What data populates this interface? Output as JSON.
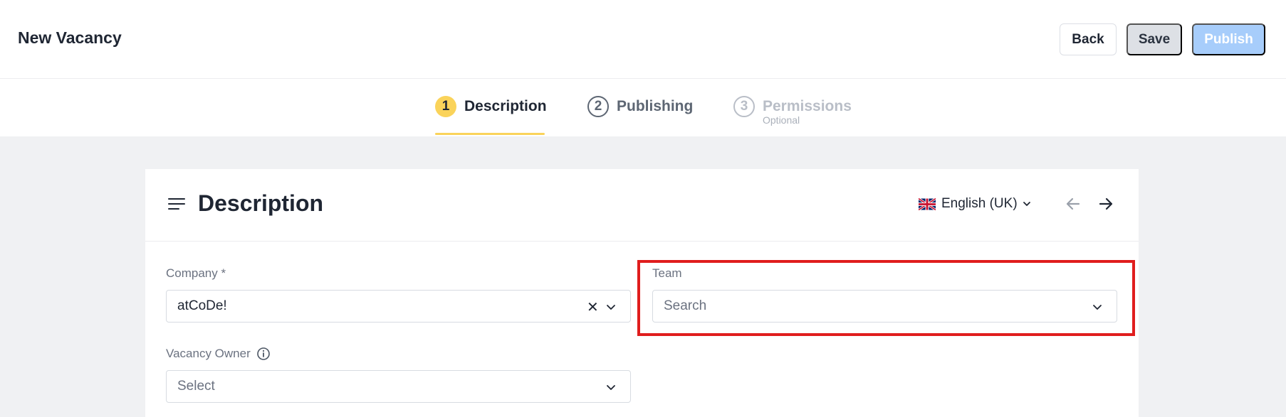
{
  "header": {
    "title": "New Vacancy",
    "back_label": "Back",
    "save_label": "Save",
    "publish_label": "Publish"
  },
  "steps": [
    {
      "number": "1",
      "label": "Description",
      "sub": ""
    },
    {
      "number": "2",
      "label": "Publishing",
      "sub": ""
    },
    {
      "number": "3",
      "label": "Permissions",
      "sub": "Optional"
    }
  ],
  "card": {
    "title": "Description",
    "language": "English (UK)"
  },
  "form": {
    "company": {
      "label": "Company *",
      "value": "atCoDe!"
    },
    "team": {
      "label": "Team",
      "placeholder": "Search"
    },
    "owner": {
      "label": "Vacancy Owner",
      "placeholder": "Select"
    }
  },
  "colors": {
    "accent": "#fad35a",
    "publish_disabled": "#a7cdfb",
    "highlight": "#e01d1d"
  }
}
